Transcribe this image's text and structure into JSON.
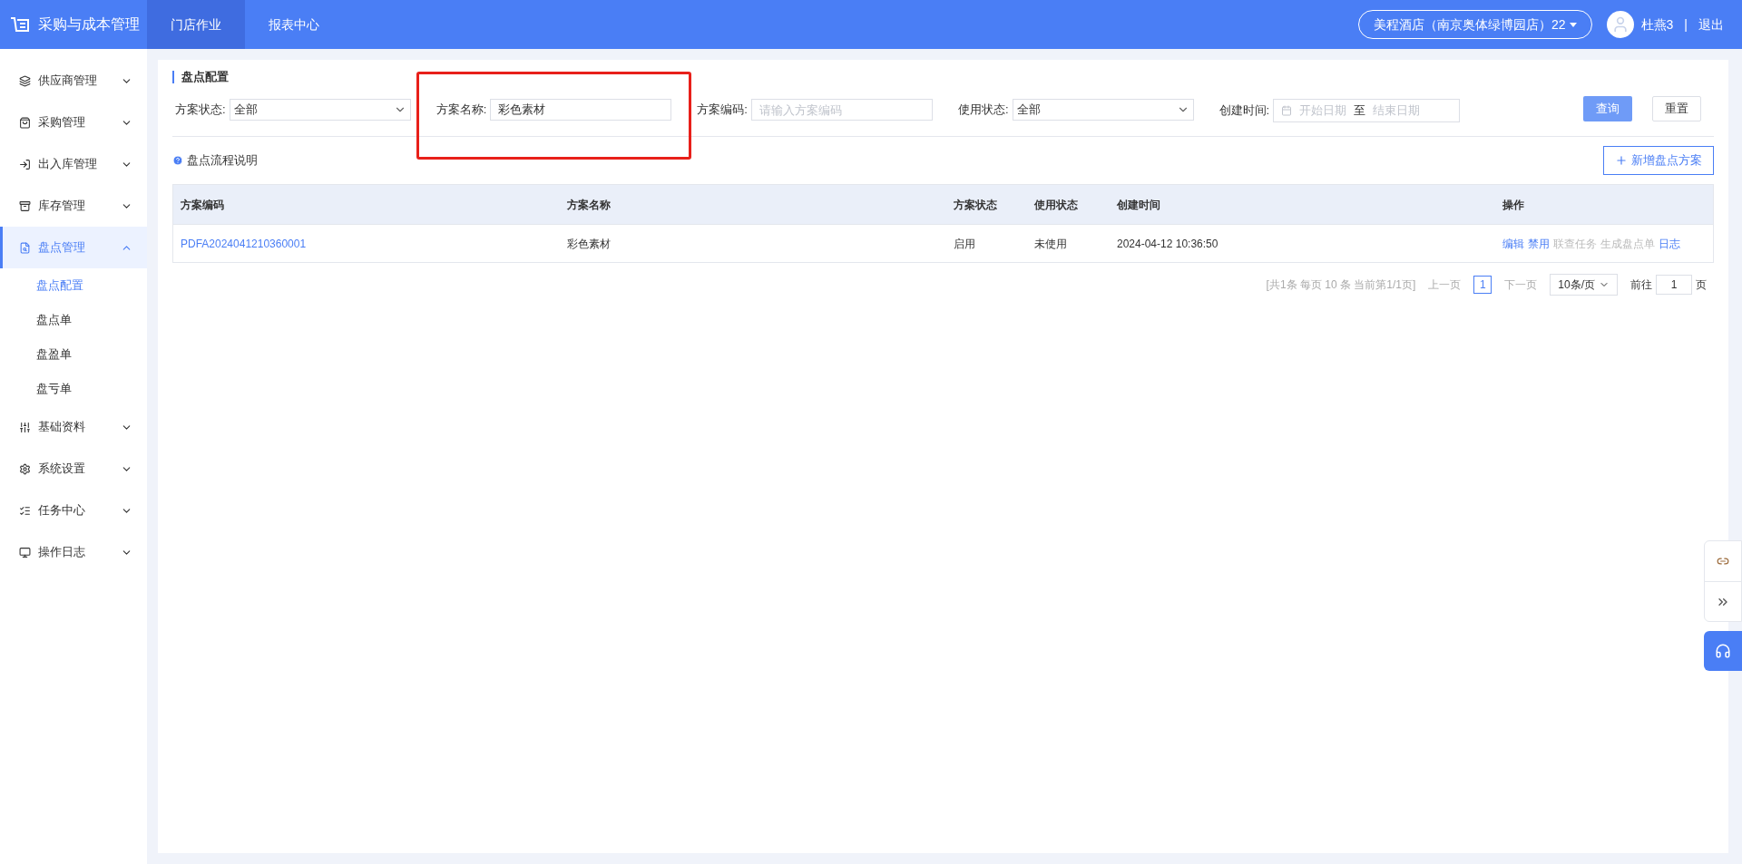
{
  "app": {
    "title": "采购与成本管理"
  },
  "top_nav": [
    {
      "label": "门店作业",
      "selected": true
    },
    {
      "label": "报表中心",
      "selected": false
    }
  ],
  "store_selector": "美程酒店（南京奥体绿博园店）22",
  "user": {
    "name": "杜燕3",
    "separator": "|",
    "logout": "退出"
  },
  "sidebar": [
    {
      "label": "供应商管理",
      "expanded": false,
      "selected": false
    },
    {
      "label": "采购管理",
      "expanded": false,
      "selected": false
    },
    {
      "label": "出入库管理",
      "expanded": false,
      "selected": false
    },
    {
      "label": "库存管理",
      "expanded": false,
      "selected": false
    },
    {
      "label": "盘点管理",
      "expanded": true,
      "selected": true,
      "children": [
        {
          "label": "盘点配置",
          "selected": true
        },
        {
          "label": "盘点单",
          "selected": false
        },
        {
          "label": "盘盈单",
          "selected": false
        },
        {
          "label": "盘亏单",
          "selected": false
        }
      ]
    },
    {
      "label": "基础资料",
      "expanded": false,
      "selected": false
    },
    {
      "label": "系统设置",
      "expanded": false,
      "selected": false
    },
    {
      "label": "任务中心",
      "expanded": false,
      "selected": false
    },
    {
      "label": "操作日志",
      "expanded": false,
      "selected": false
    }
  ],
  "page_title": "盘点配置",
  "filters": [
    {
      "kind": "select",
      "label": "方案状态:",
      "value": "全部",
      "highlighted": false
    },
    {
      "kind": "input",
      "label": "方案名称:",
      "value": "彩色素材",
      "highlighted": true
    },
    {
      "kind": "input",
      "label": "方案编码:",
      "placeholder": "请输入方案编码",
      "highlighted": false
    },
    {
      "kind": "select",
      "label": "使用状态:",
      "value": "全部",
      "highlighted": false
    },
    {
      "kind": "daterange",
      "label": "创建时间:",
      "start_placeholder": "开始日期",
      "separator": "至",
      "end_placeholder": "结束日期",
      "highlighted": false
    }
  ],
  "buttons": {
    "query": "查询",
    "reset": "重置"
  },
  "help_link": "盘点流程说明",
  "add_button": "新增盘点方案",
  "table": {
    "columns": [
      "方案编码",
      "方案名称",
      "方案状态",
      "使用状态",
      "创建时间",
      "操作"
    ],
    "rows": [
      {
        "code": "PDFA2024041210360001",
        "name": "彩色素材",
        "plan_status": "启用",
        "use_status": "未使用",
        "created": "2024-04-12 10:36:50",
        "actions": [
          {
            "label": "编辑",
            "disabled": false
          },
          {
            "label": "禁用",
            "disabled": false
          },
          {
            "label": "联查任务",
            "disabled": true
          },
          {
            "label": "生成盘点单",
            "disabled": true
          },
          {
            "label": "日志",
            "disabled": false
          }
        ]
      }
    ]
  },
  "pagination": {
    "summary": "[共1条 每页 10 条 当前第1/1页]",
    "prev": "上一页",
    "pages": [
      {
        "label": "1",
        "selected": true
      }
    ],
    "next": "下一页",
    "page_size": "10条/页",
    "goto_label": "前往",
    "goto_value": "1",
    "goto_suffix": "页"
  }
}
